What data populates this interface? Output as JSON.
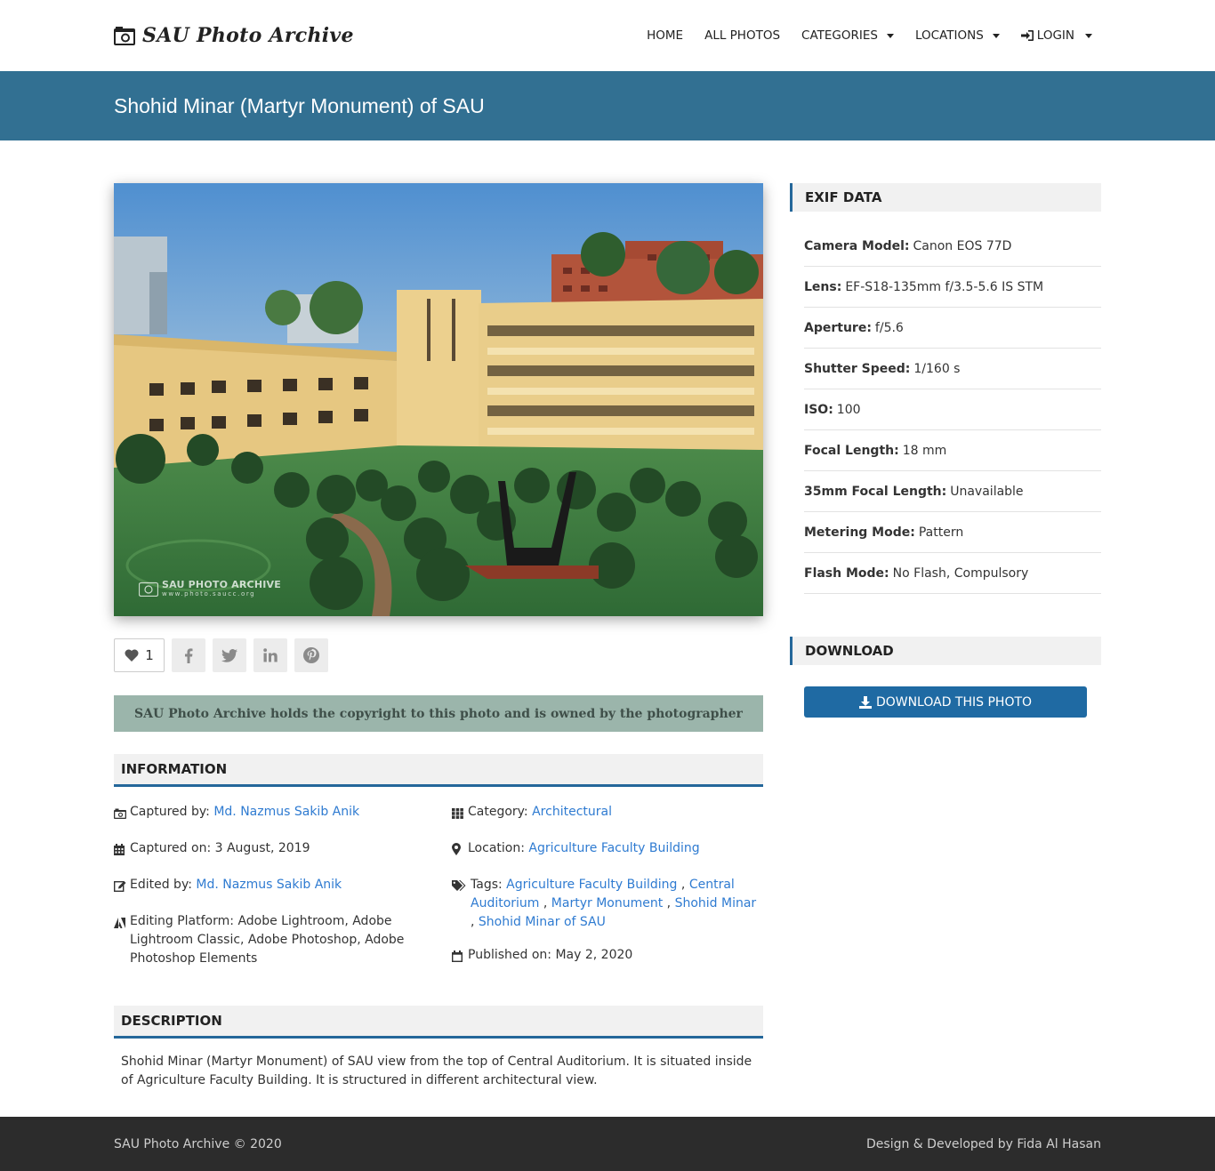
{
  "brand": {
    "name": "SAU Photo Archive"
  },
  "nav": {
    "home": "HOME",
    "all_photos": "ALL PHOTOS",
    "categories": "CATEGORIES",
    "locations": "LOCATIONS",
    "login": "LOGIN"
  },
  "page": {
    "title": "Shohid Minar (Martyr Monument) of SAU"
  },
  "photo": {
    "watermark_title": "SAU PHOTO ARCHIVE",
    "watermark_sub": "www.photo.saucc.org"
  },
  "social": {
    "like_count": "1"
  },
  "copyright_notice": "SAU Photo Archive holds the copyright to this photo and is owned by the photographer",
  "information": {
    "heading": "INFORMATION",
    "captured_by_label": "Captured by:",
    "captured_by": "Md. Nazmus Sakib Anik",
    "captured_on_label": "Captured on:",
    "captured_on": "3 August, 2019",
    "edited_by_label": "Edited by:",
    "edited_by": "Md. Nazmus Sakib Anik",
    "platform_label": "Editing Platform:",
    "platform": "Adobe Lightroom, Adobe Lightroom Classic, Adobe Photoshop, Adobe Photoshop Elements",
    "category_label": "Category:",
    "category": "Architectural",
    "location_label": "Location:",
    "location": "Agriculture Faculty Building",
    "tags_label": "Tags:",
    "tags": [
      "Agriculture Faculty Building",
      "Central Auditorium",
      "Martyr Monument",
      "Shohid Minar",
      "Shohid Minar of SAU"
    ],
    "published_label": "Published on:",
    "published": "May 2, 2020"
  },
  "description": {
    "heading": "DESCRIPTION",
    "text": "Shohid Minar (Martyr Monument) of SAU view from the top of Central Auditorium. It is situated inside of Agriculture Faculty Building. It is structured in different architectural view."
  },
  "exif": {
    "heading": "EXIF DATA",
    "rows": [
      {
        "label": "Camera Model:",
        "value": "Canon EOS 77D"
      },
      {
        "label": "Lens:",
        "value": "EF-S18-135mm f/3.5-5.6 IS STM"
      },
      {
        "label": "Aperture:",
        "value": "f/5.6"
      },
      {
        "label": "Shutter Speed:",
        "value": "1/160 s"
      },
      {
        "label": "ISO:",
        "value": "100"
      },
      {
        "label": "Focal Length:",
        "value": "18 mm"
      },
      {
        "label": "35mm Focal Length:",
        "value": "Unavailable"
      },
      {
        "label": "Metering Mode:",
        "value": "Pattern"
      },
      {
        "label": "Flash Mode:",
        "value": "No Flash, Compulsory"
      }
    ]
  },
  "download": {
    "heading": "DOWNLOAD",
    "button": "DOWNLOAD THIS PHOTO"
  },
  "footer": {
    "left": "SAU Photo Archive © 2020",
    "right": "Design & Developed by Fida Al Hasan"
  },
  "colors": {
    "titlebar": "#327092",
    "accent": "#24679a",
    "link": "#2f7bd1",
    "download": "#1f6aa3",
    "footer": "#2c2c2c"
  }
}
